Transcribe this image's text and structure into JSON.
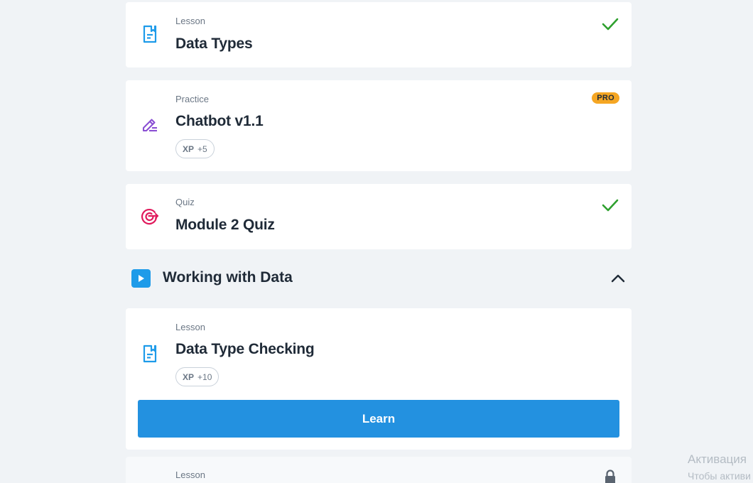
{
  "items": [
    {
      "type": "Lesson",
      "title": "Data Types",
      "status": "completed",
      "icon": "lesson-icon"
    },
    {
      "type": "Practice",
      "title": "Chatbot v1.1",
      "badge": "PRO",
      "xp_label": "XP",
      "xp_value": "+5",
      "icon": "practice-icon"
    },
    {
      "type": "Quiz",
      "title": "Module 2 Quiz",
      "status": "completed",
      "icon": "quiz-icon"
    }
  ],
  "module": {
    "title": "Working with Data",
    "icon": "play-icon",
    "expanded": true
  },
  "current": {
    "type": "Lesson",
    "title": "Data Type Checking",
    "xp_label": "XP",
    "xp_value": "+10",
    "button_label": "Learn",
    "icon": "lesson-icon"
  },
  "next": {
    "type": "Lesson",
    "status": "locked",
    "icon": "lesson-icon"
  },
  "watermark": {
    "line1": "Активация",
    "line2": "Чтобы активи"
  },
  "colors": {
    "accent": "#2391e0",
    "success": "#2ea02e",
    "pro": "#f5a623",
    "quiz": "#e0195c",
    "practice": "#8a4fd3",
    "lesson": "#1e9be9"
  }
}
